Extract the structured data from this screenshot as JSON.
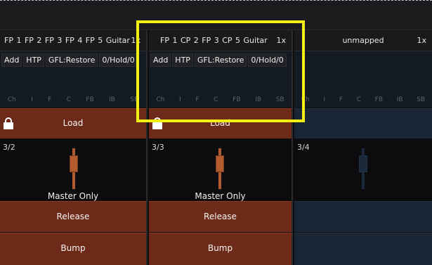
{
  "columns": [
    {
      "header": "FP 1 FP 2 FP 3 FP 4 FP 5  Guitar",
      "multiplier": "1x",
      "buttons": [
        "Add",
        "HTP",
        "GFL:Restore",
        "0/Hold/0"
      ],
      "params": [
        "Ch",
        "I",
        "F",
        "C",
        "FB",
        "IB",
        "SB"
      ],
      "load_label": "Load",
      "fader_id": "3/2",
      "fader_level": 0.5,
      "mode_label": "Master Only",
      "release_label": "Release",
      "bump_label": "Bump"
    },
    {
      "header": "FP 1 CP 2 FP 3 CP 5  Guitar",
      "multiplier": "1x",
      "buttons": [
        "Add",
        "HTP",
        "GFL:Restore",
        "0/Hold/0"
      ],
      "params": [
        "Ch",
        "I",
        "F",
        "C",
        "FB",
        "IB",
        "SB"
      ],
      "load_label": "Load",
      "fader_id": "3/3",
      "fader_level": 0.5,
      "mode_label": "Master Only",
      "release_label": "Release",
      "bump_label": "Bump"
    },
    {
      "header": "unmapped",
      "multiplier": "1x",
      "params": [
        "Ch",
        "I",
        "F",
        "C",
        "FB",
        "IB",
        "SB"
      ],
      "fader_id": "3/4",
      "fader_level": 0.5
    }
  ],
  "colors": {
    "active": "#6e2a18",
    "inactive": "#1a2636",
    "highlight": "#f3ee14"
  }
}
